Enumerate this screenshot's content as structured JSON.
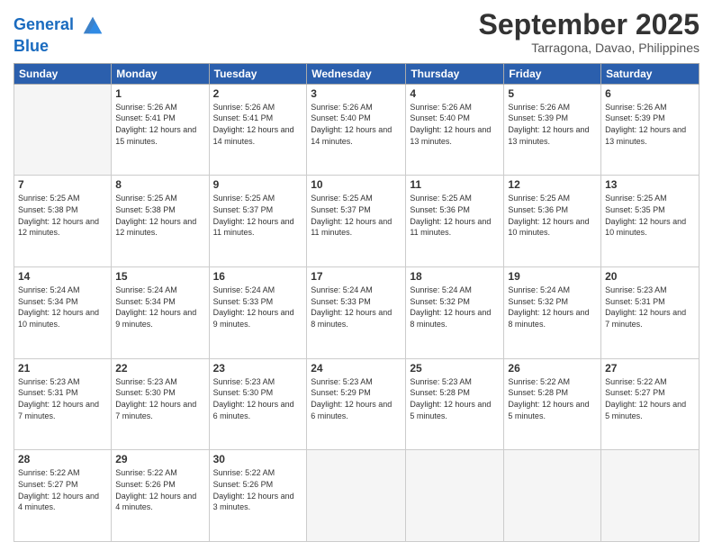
{
  "logo": {
    "line1": "General",
    "line2": "Blue"
  },
  "title": "September 2025",
  "subtitle": "Tarragona, Davao, Philippines",
  "headers": [
    "Sunday",
    "Monday",
    "Tuesday",
    "Wednesday",
    "Thursday",
    "Friday",
    "Saturday"
  ],
  "weeks": [
    [
      {
        "day": "",
        "sunrise": "",
        "sunset": "",
        "daylight": "",
        "empty": true
      },
      {
        "day": "1",
        "sunrise": "Sunrise: 5:26 AM",
        "sunset": "Sunset: 5:41 PM",
        "daylight": "Daylight: 12 hours and 15 minutes."
      },
      {
        "day": "2",
        "sunrise": "Sunrise: 5:26 AM",
        "sunset": "Sunset: 5:41 PM",
        "daylight": "Daylight: 12 hours and 14 minutes."
      },
      {
        "day": "3",
        "sunrise": "Sunrise: 5:26 AM",
        "sunset": "Sunset: 5:40 PM",
        "daylight": "Daylight: 12 hours and 14 minutes."
      },
      {
        "day": "4",
        "sunrise": "Sunrise: 5:26 AM",
        "sunset": "Sunset: 5:40 PM",
        "daylight": "Daylight: 12 hours and 13 minutes."
      },
      {
        "day": "5",
        "sunrise": "Sunrise: 5:26 AM",
        "sunset": "Sunset: 5:39 PM",
        "daylight": "Daylight: 12 hours and 13 minutes."
      },
      {
        "day": "6",
        "sunrise": "Sunrise: 5:26 AM",
        "sunset": "Sunset: 5:39 PM",
        "daylight": "Daylight: 12 hours and 13 minutes."
      }
    ],
    [
      {
        "day": "7",
        "sunrise": "Sunrise: 5:25 AM",
        "sunset": "Sunset: 5:38 PM",
        "daylight": "Daylight: 12 hours and 12 minutes."
      },
      {
        "day": "8",
        "sunrise": "Sunrise: 5:25 AM",
        "sunset": "Sunset: 5:38 PM",
        "daylight": "Daylight: 12 hours and 12 minutes."
      },
      {
        "day": "9",
        "sunrise": "Sunrise: 5:25 AM",
        "sunset": "Sunset: 5:37 PM",
        "daylight": "Daylight: 12 hours and 11 minutes."
      },
      {
        "day": "10",
        "sunrise": "Sunrise: 5:25 AM",
        "sunset": "Sunset: 5:37 PM",
        "daylight": "Daylight: 12 hours and 11 minutes."
      },
      {
        "day": "11",
        "sunrise": "Sunrise: 5:25 AM",
        "sunset": "Sunset: 5:36 PM",
        "daylight": "Daylight: 12 hours and 11 minutes."
      },
      {
        "day": "12",
        "sunrise": "Sunrise: 5:25 AM",
        "sunset": "Sunset: 5:36 PM",
        "daylight": "Daylight: 12 hours and 10 minutes."
      },
      {
        "day": "13",
        "sunrise": "Sunrise: 5:25 AM",
        "sunset": "Sunset: 5:35 PM",
        "daylight": "Daylight: 12 hours and 10 minutes."
      }
    ],
    [
      {
        "day": "14",
        "sunrise": "Sunrise: 5:24 AM",
        "sunset": "Sunset: 5:34 PM",
        "daylight": "Daylight: 12 hours and 10 minutes."
      },
      {
        "day": "15",
        "sunrise": "Sunrise: 5:24 AM",
        "sunset": "Sunset: 5:34 PM",
        "daylight": "Daylight: 12 hours and 9 minutes."
      },
      {
        "day": "16",
        "sunrise": "Sunrise: 5:24 AM",
        "sunset": "Sunset: 5:33 PM",
        "daylight": "Daylight: 12 hours and 9 minutes."
      },
      {
        "day": "17",
        "sunrise": "Sunrise: 5:24 AM",
        "sunset": "Sunset: 5:33 PM",
        "daylight": "Daylight: 12 hours and 8 minutes."
      },
      {
        "day": "18",
        "sunrise": "Sunrise: 5:24 AM",
        "sunset": "Sunset: 5:32 PM",
        "daylight": "Daylight: 12 hours and 8 minutes."
      },
      {
        "day": "19",
        "sunrise": "Sunrise: 5:24 AM",
        "sunset": "Sunset: 5:32 PM",
        "daylight": "Daylight: 12 hours and 8 minutes."
      },
      {
        "day": "20",
        "sunrise": "Sunrise: 5:23 AM",
        "sunset": "Sunset: 5:31 PM",
        "daylight": "Daylight: 12 hours and 7 minutes."
      }
    ],
    [
      {
        "day": "21",
        "sunrise": "Sunrise: 5:23 AM",
        "sunset": "Sunset: 5:31 PM",
        "daylight": "Daylight: 12 hours and 7 minutes."
      },
      {
        "day": "22",
        "sunrise": "Sunrise: 5:23 AM",
        "sunset": "Sunset: 5:30 PM",
        "daylight": "Daylight: 12 hours and 7 minutes."
      },
      {
        "day": "23",
        "sunrise": "Sunrise: 5:23 AM",
        "sunset": "Sunset: 5:30 PM",
        "daylight": "Daylight: 12 hours and 6 minutes."
      },
      {
        "day": "24",
        "sunrise": "Sunrise: 5:23 AM",
        "sunset": "Sunset: 5:29 PM",
        "daylight": "Daylight: 12 hours and 6 minutes."
      },
      {
        "day": "25",
        "sunrise": "Sunrise: 5:23 AM",
        "sunset": "Sunset: 5:28 PM",
        "daylight": "Daylight: 12 hours and 5 minutes."
      },
      {
        "day": "26",
        "sunrise": "Sunrise: 5:22 AM",
        "sunset": "Sunset: 5:28 PM",
        "daylight": "Daylight: 12 hours and 5 minutes."
      },
      {
        "day": "27",
        "sunrise": "Sunrise: 5:22 AM",
        "sunset": "Sunset: 5:27 PM",
        "daylight": "Daylight: 12 hours and 5 minutes."
      }
    ],
    [
      {
        "day": "28",
        "sunrise": "Sunrise: 5:22 AM",
        "sunset": "Sunset: 5:27 PM",
        "daylight": "Daylight: 12 hours and 4 minutes."
      },
      {
        "day": "29",
        "sunrise": "Sunrise: 5:22 AM",
        "sunset": "Sunset: 5:26 PM",
        "daylight": "Daylight: 12 hours and 4 minutes."
      },
      {
        "day": "30",
        "sunrise": "Sunrise: 5:22 AM",
        "sunset": "Sunset: 5:26 PM",
        "daylight": "Daylight: 12 hours and 3 minutes."
      },
      {
        "day": "",
        "sunrise": "",
        "sunset": "",
        "daylight": "",
        "empty": true
      },
      {
        "day": "",
        "sunrise": "",
        "sunset": "",
        "daylight": "",
        "empty": true
      },
      {
        "day": "",
        "sunrise": "",
        "sunset": "",
        "daylight": "",
        "empty": true
      },
      {
        "day": "",
        "sunrise": "",
        "sunset": "",
        "daylight": "",
        "empty": true
      }
    ]
  ]
}
